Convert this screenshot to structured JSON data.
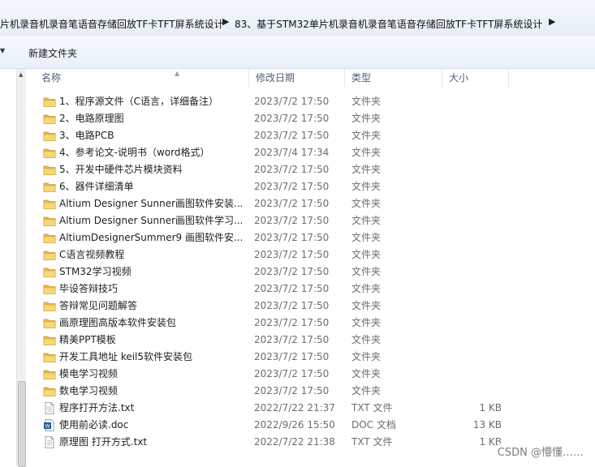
{
  "breadcrumb": {
    "items": [
      "片机录音机录音笔语音存储回放TF卡TFT屏系统设计",
      "83、基于STM32单片机录音机录音笔语音存储回放TF卡TFT屏系统设计"
    ]
  },
  "toolbar": {
    "new_folder": "新建文件夹"
  },
  "columns": {
    "name": "名称",
    "date": "修改日期",
    "type": "类型",
    "size": "大小"
  },
  "files": [
    {
      "name": "1、程序源文件（C语言，详细备注）",
      "date": "2023/7/2 17:50",
      "type": "文件夹",
      "size": "",
      "icon": "folder-icon"
    },
    {
      "name": "2、电路原理图",
      "date": "2023/7/2 17:50",
      "type": "文件夹",
      "size": "",
      "icon": "folder-icon"
    },
    {
      "name": "3、电路PCB",
      "date": "2023/7/2 17:50",
      "type": "文件夹",
      "size": "",
      "icon": "folder-icon"
    },
    {
      "name": "4、参考论文-说明书（word格式）",
      "date": "2023/7/4 17:34",
      "type": "文件夹",
      "size": "",
      "icon": "folder-icon"
    },
    {
      "name": "5、开发中硬件芯片模块资料",
      "date": "2023/7/2 17:50",
      "type": "文件夹",
      "size": "",
      "icon": "folder-icon"
    },
    {
      "name": "6、器件详细清单",
      "date": "2023/7/2 17:50",
      "type": "文件夹",
      "size": "",
      "icon": "folder-icon"
    },
    {
      "name": "Altium Designer Sunner画图软件安装...",
      "date": "2023/7/2 17:50",
      "type": "文件夹",
      "size": "",
      "icon": "folder-icon"
    },
    {
      "name": "Altium Designer Sunner画图软件学习...",
      "date": "2023/7/2 17:50",
      "type": "文件夹",
      "size": "",
      "icon": "folder-icon"
    },
    {
      "name": "AltiumDesignerSummer9 画图软件安...",
      "date": "2023/7/2 17:50",
      "type": "文件夹",
      "size": "",
      "icon": "folder-icon"
    },
    {
      "name": "C语言视频教程",
      "date": "2023/7/2 17:50",
      "type": "文件夹",
      "size": "",
      "icon": "folder-icon"
    },
    {
      "name": "STM32学习视频",
      "date": "2023/7/2 17:50",
      "type": "文件夹",
      "size": "",
      "icon": "folder-icon"
    },
    {
      "name": "毕设答辩技巧",
      "date": "2023/7/2 17:50",
      "type": "文件夹",
      "size": "",
      "icon": "folder-icon"
    },
    {
      "name": "答辩常见问题解答",
      "date": "2023/7/2 17:50",
      "type": "文件夹",
      "size": "",
      "icon": "folder-icon"
    },
    {
      "name": "画原理图高版本软件安装包",
      "date": "2023/7/2 17:50",
      "type": "文件夹",
      "size": "",
      "icon": "folder-icon"
    },
    {
      "name": "精美PPT模板",
      "date": "2023/7/2 17:50",
      "type": "文件夹",
      "size": "",
      "icon": "folder-icon"
    },
    {
      "name": "开发工具地址 keil5软件安装包",
      "date": "2023/7/2 17:50",
      "type": "文件夹",
      "size": "",
      "icon": "folder-icon"
    },
    {
      "name": "模电学习视频",
      "date": "2023/7/2 17:50",
      "type": "文件夹",
      "size": "",
      "icon": "folder-icon"
    },
    {
      "name": "数电学习视频",
      "date": "2023/7/2 17:50",
      "type": "文件夹",
      "size": "",
      "icon": "folder-icon"
    },
    {
      "name": "程序打开方法.txt",
      "date": "2022/7/22 21:37",
      "type": "TXT 文件",
      "size": "1 KB",
      "icon": "txt-file-icon"
    },
    {
      "name": "使用前必读.doc",
      "date": "2022/9/26 15:50",
      "type": "DOC 文档",
      "size": "13 KB",
      "icon": "doc-file-icon"
    },
    {
      "name": "原理图 打开方式.txt",
      "date": "2022/7/22 21:38",
      "type": "TXT 文件",
      "size": "1 KB",
      "icon": "txt-file-icon"
    }
  ],
  "watermark": "CSDN @懵懂……"
}
